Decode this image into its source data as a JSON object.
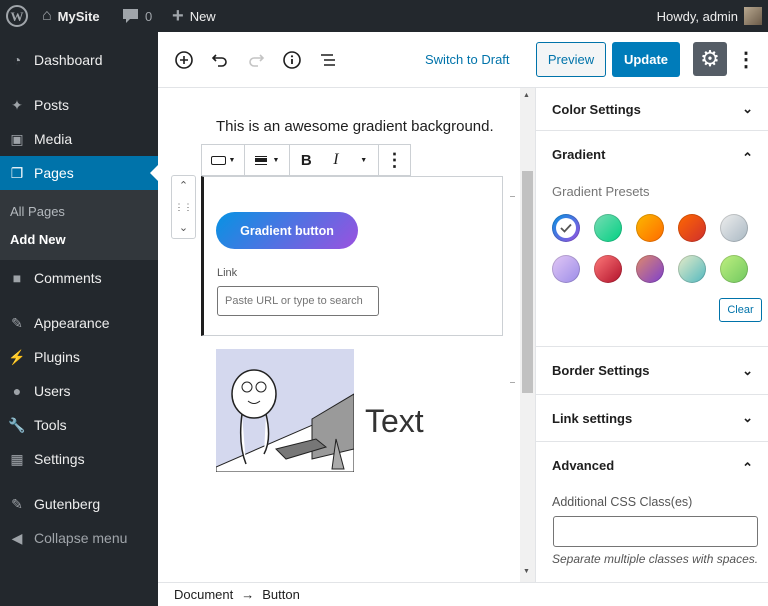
{
  "adminbar": {
    "site": "MySite",
    "comments": "0",
    "new": "New",
    "howdy": "Howdy, admin"
  },
  "sidebar": {
    "items": [
      {
        "label": "Dashboard",
        "icon": "dashboard-icon"
      },
      {
        "label": "Posts",
        "icon": "pin-icon"
      },
      {
        "label": "Media",
        "icon": "media-icon"
      },
      {
        "label": "Pages",
        "icon": "pages-icon",
        "active": true
      },
      {
        "label": "Comments",
        "icon": "comment-icon"
      },
      {
        "label": "Appearance",
        "icon": "brush-icon"
      },
      {
        "label": "Plugins",
        "icon": "plugin-icon"
      },
      {
        "label": "Users",
        "icon": "user-icon"
      },
      {
        "label": "Tools",
        "icon": "wrench-icon"
      },
      {
        "label": "Settings",
        "icon": "settings-icon"
      },
      {
        "label": "Gutenberg",
        "icon": "gutenberg-icon"
      },
      {
        "label": "Collapse menu",
        "icon": "collapse-icon"
      }
    ],
    "submenu": [
      "All Pages",
      "Add New"
    ]
  },
  "header": {
    "switch_draft": "Switch to Draft",
    "preview": "Preview",
    "update": "Update"
  },
  "content": {
    "paragraph": "This is an awesome gradient background.",
    "button_text": "Gradient button",
    "link_label": "Link",
    "link_placeholder": "Paste URL or type to search",
    "media_text": "Text"
  },
  "panel": {
    "color_settings": "Color Settings",
    "gradient": "Gradient",
    "gradient_presets": "Gradient Presets",
    "clear": "Clear",
    "border_settings": "Border Settings",
    "link_settings": "Link settings",
    "advanced": "Advanced",
    "css_label": "Additional CSS Class(es)",
    "css_value": "",
    "css_help": "Separate multiple classes with spaces.",
    "swatches": [
      {
        "name": "vivid-cyan-blue-to-vivid-purple",
        "from": "#0693e3",
        "to": "#9b51e0",
        "selected": true
      },
      {
        "name": "light-green-cyan-to-vivid-green-cyan",
        "from": "#7adcb4",
        "to": "#00d082"
      },
      {
        "name": "luminous-vivid-amber-to-luminous-vivid-orange",
        "from": "#fcb900",
        "to": "#ff6900"
      },
      {
        "name": "luminous-vivid-orange-to-vivid-red",
        "from": "#ff6900",
        "to": "#cf2e2e"
      },
      {
        "name": "very-light-gray-to-cyan-bluish-gray",
        "from": "#eeeeee",
        "to": "#a9b8c3"
      },
      {
        "name": "cool-to-warm-spectrum",
        "from": "#e3c8f5",
        "to": "#9b8ce8"
      },
      {
        "name": "blush-light-purple",
        "from": "#ff7a7a",
        "to": "#b0102a"
      },
      {
        "name": "blush-bordeaux",
        "from": "#e08a6a",
        "to": "#7c3fd0"
      },
      {
        "name": "luminous-dusk",
        "from": "#e8ecc8",
        "to": "#50b8c0"
      },
      {
        "name": "pale-ocean",
        "from": "#c0f080",
        "to": "#70c860"
      }
    ]
  },
  "footer": {
    "crumbs": [
      "Document",
      "Button"
    ],
    "separator": "→"
  },
  "colors": {
    "accent": "#0073aa",
    "adminbar": "#23282d",
    "submenu": "#32373c",
    "update": "#007cba"
  }
}
